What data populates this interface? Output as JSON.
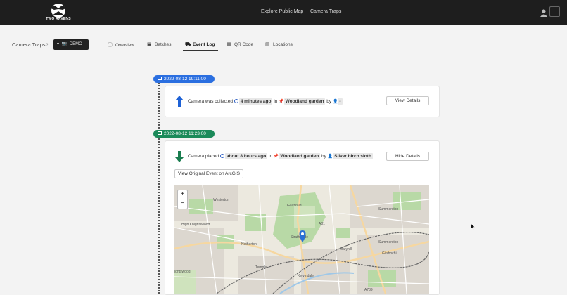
{
  "brand": {
    "name": "TWO RAVENS"
  },
  "nav": {
    "explore": "Explore Public Map",
    "traps": "Camera Traps"
  },
  "user": {
    "menu": "···"
  },
  "breadcrumb": {
    "root": "Camera Traps",
    "separator": "›",
    "project": "DEMO"
  },
  "tabs": [
    {
      "label": "Overview",
      "icon": "info-icon"
    },
    {
      "label": "Batches",
      "icon": "images-icon"
    },
    {
      "label": "Event Log",
      "icon": "truck-icon",
      "active": true
    },
    {
      "label": "QR Code",
      "icon": "qrcode-icon"
    },
    {
      "label": "Locations",
      "icon": "map-icon"
    }
  ],
  "events": [
    {
      "timestamp": "2022-08-12 19:11:00",
      "color": "#2b6fe0",
      "action": "Camera was collected",
      "time_ago": "4 minutes ago",
      "in": "in",
      "location": "Woodland garden",
      "by": "by",
      "person": "-",
      "button": "View Details",
      "arrow_color": "#1e62d6"
    },
    {
      "timestamp": "2022-08-12 11:23:00",
      "color": "#1b8a5a",
      "action": "Camera placed",
      "time_ago": "about 8 hours ago",
      "in": "in",
      "location": "Woodland garden",
      "by": "by",
      "person": "Silver birch sloth",
      "button": "Hide Details",
      "original_button": "View Original Event on ArcGIS",
      "arrow_color": "#1a7d4f"
    }
  ],
  "map": {
    "labels": [
      "Westerton",
      "High Knightswood",
      "Netherton",
      "Summerston",
      "Summerston",
      "Maryhill",
      "Gilshochil",
      "Temple",
      "ightswood",
      "Kelvindale",
      "Gairbraid",
      "A81",
      "A739",
      "Strathclyde"
    ],
    "zoom_in": "+",
    "zoom_out": "−"
  }
}
